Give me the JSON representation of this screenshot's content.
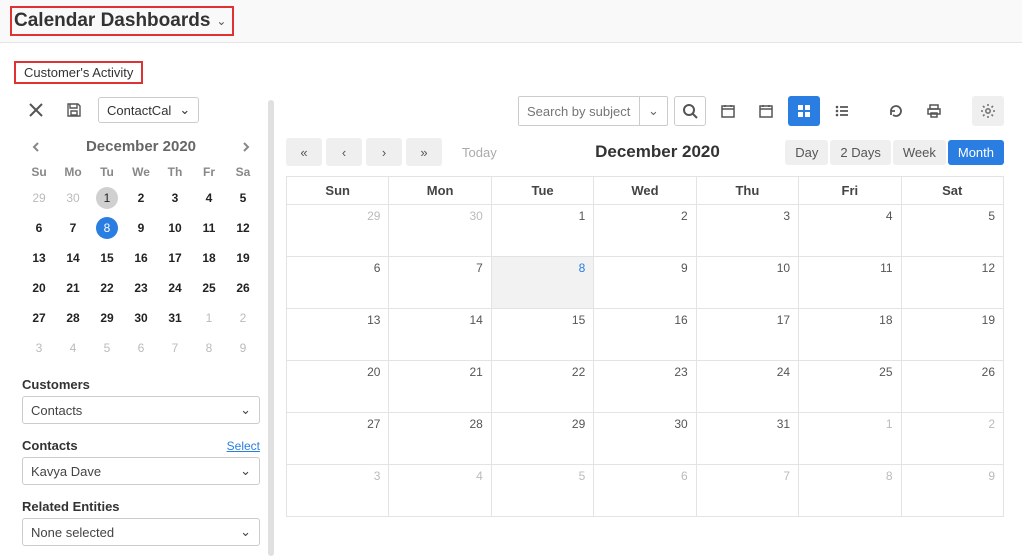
{
  "header": {
    "title": "Calendar Dashboards"
  },
  "tab": {
    "label": "Customer's Activity"
  },
  "sidebar": {
    "calendar_select": "ContactCal",
    "minical": {
      "title": "December 2020",
      "dow": [
        "Su",
        "Mo",
        "Tu",
        "We",
        "Th",
        "Fr",
        "Sa"
      ],
      "weeks": [
        [
          {
            "d": 29,
            "t": "out"
          },
          {
            "d": 30,
            "t": "out"
          },
          {
            "d": 1,
            "t": "today"
          },
          {
            "d": 2,
            "t": "in"
          },
          {
            "d": 3,
            "t": "in"
          },
          {
            "d": 4,
            "t": "in"
          },
          {
            "d": 5,
            "t": "in"
          }
        ],
        [
          {
            "d": 6,
            "t": "in"
          },
          {
            "d": 7,
            "t": "in"
          },
          {
            "d": 8,
            "t": "selected"
          },
          {
            "d": 9,
            "t": "in"
          },
          {
            "d": 10,
            "t": "in"
          },
          {
            "d": 11,
            "t": "in"
          },
          {
            "d": 12,
            "t": "in"
          }
        ],
        [
          {
            "d": 13,
            "t": "in"
          },
          {
            "d": 14,
            "t": "in"
          },
          {
            "d": 15,
            "t": "in"
          },
          {
            "d": 16,
            "t": "in"
          },
          {
            "d": 17,
            "t": "in"
          },
          {
            "d": 18,
            "t": "in"
          },
          {
            "d": 19,
            "t": "in"
          }
        ],
        [
          {
            "d": 20,
            "t": "in"
          },
          {
            "d": 21,
            "t": "in"
          },
          {
            "d": 22,
            "t": "in"
          },
          {
            "d": 23,
            "t": "in"
          },
          {
            "d": 24,
            "t": "in"
          },
          {
            "d": 25,
            "t": "in"
          },
          {
            "d": 26,
            "t": "in"
          }
        ],
        [
          {
            "d": 27,
            "t": "in"
          },
          {
            "d": 28,
            "t": "in"
          },
          {
            "d": 29,
            "t": "in"
          },
          {
            "d": 30,
            "t": "in"
          },
          {
            "d": 31,
            "t": "in"
          },
          {
            "d": 1,
            "t": "out"
          },
          {
            "d": 2,
            "t": "out"
          }
        ],
        [
          {
            "d": 3,
            "t": "out"
          },
          {
            "d": 4,
            "t": "out"
          },
          {
            "d": 5,
            "t": "out"
          },
          {
            "d": 6,
            "t": "out"
          },
          {
            "d": 7,
            "t": "out"
          },
          {
            "d": 8,
            "t": "out"
          },
          {
            "d": 9,
            "t": "out"
          }
        ]
      ]
    },
    "customers": {
      "label": "Customers",
      "value": "Contacts"
    },
    "contacts": {
      "label": "Contacts",
      "value": "Kavya Dave",
      "select_link": "Select"
    },
    "related": {
      "label": "Related Entities",
      "value": "None selected"
    }
  },
  "toolbar": {
    "search_placeholder": "Search by subject"
  },
  "content": {
    "today_label": "Today",
    "month_title": "December 2020",
    "views": [
      "Day",
      "2 Days",
      "Week",
      "Month"
    ],
    "active_view": "Month",
    "dow": [
      "Sun",
      "Mon",
      "Tue",
      "Wed",
      "Thu",
      "Fri",
      "Sat"
    ],
    "weeks": [
      [
        {
          "d": 29,
          "t": "out"
        },
        {
          "d": 30,
          "t": "out"
        },
        {
          "d": 1,
          "t": "in"
        },
        {
          "d": 2,
          "t": "in"
        },
        {
          "d": 3,
          "t": "in"
        },
        {
          "d": 4,
          "t": "in"
        },
        {
          "d": 5,
          "t": "in"
        }
      ],
      [
        {
          "d": 6,
          "t": "in"
        },
        {
          "d": 7,
          "t": "in"
        },
        {
          "d": 8,
          "t": "sel"
        },
        {
          "d": 9,
          "t": "in"
        },
        {
          "d": 10,
          "t": "in"
        },
        {
          "d": 11,
          "t": "in"
        },
        {
          "d": 12,
          "t": "in"
        }
      ],
      [
        {
          "d": 13,
          "t": "in"
        },
        {
          "d": 14,
          "t": "in"
        },
        {
          "d": 15,
          "t": "in"
        },
        {
          "d": 16,
          "t": "in"
        },
        {
          "d": 17,
          "t": "in"
        },
        {
          "d": 18,
          "t": "in"
        },
        {
          "d": 19,
          "t": "in"
        }
      ],
      [
        {
          "d": 20,
          "t": "in"
        },
        {
          "d": 21,
          "t": "in"
        },
        {
          "d": 22,
          "t": "in"
        },
        {
          "d": 23,
          "t": "in"
        },
        {
          "d": 24,
          "t": "in"
        },
        {
          "d": 25,
          "t": "in"
        },
        {
          "d": 26,
          "t": "in"
        }
      ],
      [
        {
          "d": 27,
          "t": "in"
        },
        {
          "d": 28,
          "t": "in"
        },
        {
          "d": 29,
          "t": "in"
        },
        {
          "d": 30,
          "t": "in"
        },
        {
          "d": 31,
          "t": "in"
        },
        {
          "d": 1,
          "t": "out"
        },
        {
          "d": 2,
          "t": "out"
        }
      ],
      [
        {
          "d": 3,
          "t": "out"
        },
        {
          "d": 4,
          "t": "out"
        },
        {
          "d": 5,
          "t": "out"
        },
        {
          "d": 6,
          "t": "out"
        },
        {
          "d": 7,
          "t": "out"
        },
        {
          "d": 8,
          "t": "out"
        },
        {
          "d": 9,
          "t": "out"
        }
      ]
    ]
  }
}
